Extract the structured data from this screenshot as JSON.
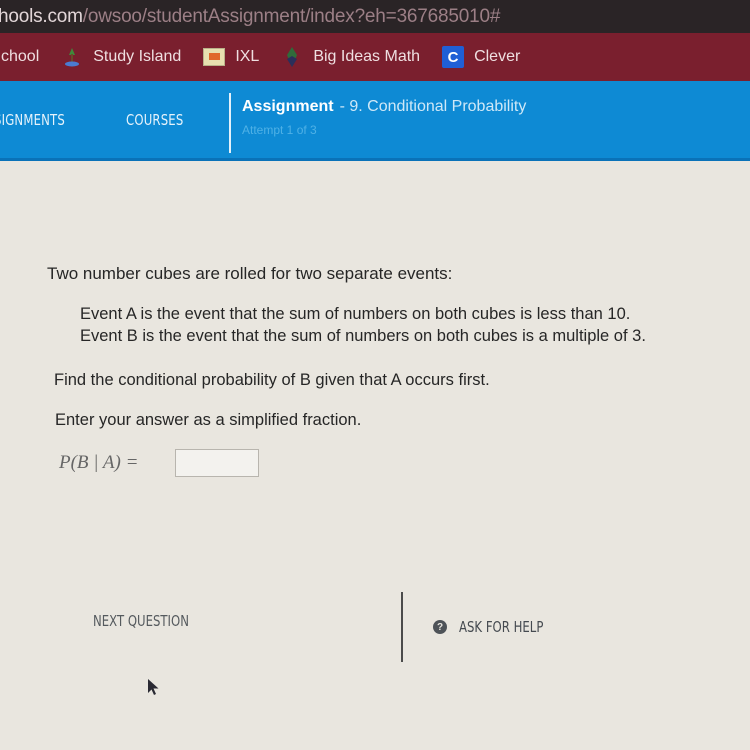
{
  "browser": {
    "url_host": "hools.com",
    "url_path": "/owsoo/studentAssignment/index?eh=367685010#",
    "bookmarks": [
      {
        "label": "chool",
        "icon": "none"
      },
      {
        "label": "Study Island",
        "icon": "study-island-icon"
      },
      {
        "label": "IXL",
        "icon": "ixl-icon"
      },
      {
        "label": "Big Ideas Math",
        "icon": "big-ideas-math-icon"
      },
      {
        "label": "Clever",
        "icon": "clever-icon",
        "icon_letter": "C"
      }
    ]
  },
  "appbar": {
    "nav": [
      {
        "label": "SIGNMENTS"
      },
      {
        "label": "COURSES"
      }
    ],
    "assignment_label": "Assignment",
    "assignment_name": "- 9. Conditional Probability",
    "attempt": "Attempt 1 of 3"
  },
  "question": {
    "intro": "Two number cubes are rolled for two separate events:",
    "events": [
      "Event A is the event that the sum of numbers on both cubes is less than 10.",
      "Event B is the event that the sum of numbers on both cubes is a multiple of 3."
    ],
    "prompt": "Find the conditional probability of B given that A occurs first.",
    "instruction": "Enter your answer as a simplified fraction.",
    "formula": "P(B | A) =",
    "answer_value": ""
  },
  "footer": {
    "next_label": "NEXT QUESTION",
    "help_label": "ASK FOR HELP",
    "help_icon_glyph": "?"
  },
  "colors": {
    "appbar": "#0e8ad4",
    "bookmarks_bar": "#7a1f2e",
    "content_bg": "#e9e6df"
  }
}
